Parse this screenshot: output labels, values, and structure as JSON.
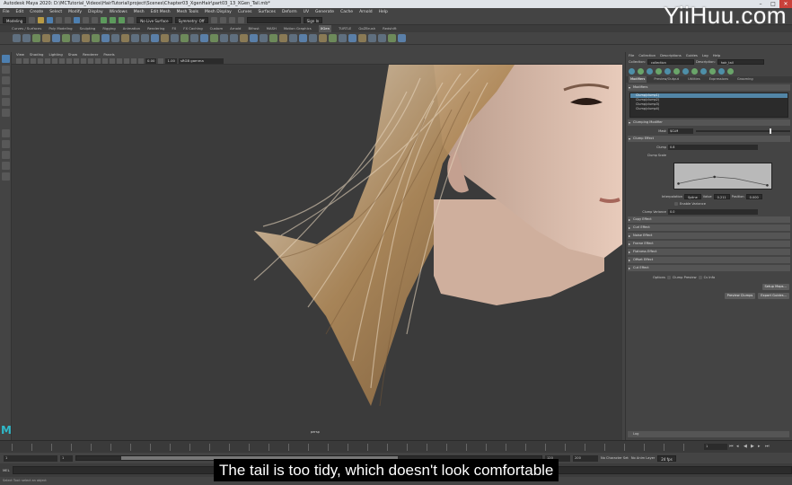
{
  "window": {
    "title": "Autodesk Maya 2020: D:\\MCTutorial_Videos\\HairTutorial\\project\\Scenes\\Chapter03_XgenHair\\part03_13_XGen_Tail.mb*",
    "controls": [
      "–",
      "□",
      "✕"
    ]
  },
  "menubar": [
    "File",
    "Edit",
    "Create",
    "Select",
    "Modify",
    "Display",
    "Windows",
    "Mesh",
    "Edit Mesh",
    "Mesh Tools",
    "Mesh Display",
    "Curves",
    "Surfaces",
    "Deform",
    "UV",
    "Generate",
    "Cache",
    "Arnold",
    "Help"
  ],
  "statusline": {
    "mode": "Modeling",
    "live_surface": "No Live Surface",
    "symmetry": "Symmetry: Off",
    "sign_in": "Sign In"
  },
  "shelf_tabs": [
    "Curves / Surfaces",
    "Poly Modeling",
    "Sculpting",
    "Rigging",
    "Animation",
    "Rendering",
    "FX",
    "FX Caching",
    "Custom",
    "Arnold",
    "Bifrost",
    "MASH",
    "Motion Graphics",
    "XGen",
    "TURTLE",
    "GoZBrush",
    "Redshift"
  ],
  "active_shelf_tab": "XGen",
  "panel_menu": [
    "View",
    "Shading",
    "Lighting",
    "Show",
    "Renderer",
    "Panels"
  ],
  "panel_tools": {
    "value_a": "0.00",
    "value_b": "1.00",
    "color_space": "sRGB gamma"
  },
  "viewport": {
    "camera_label": "persp"
  },
  "xgen": {
    "menu": [
      "File",
      "Collection",
      "Descriptions",
      "Guides",
      "Log",
      "Help"
    ],
    "collection_label": "Collection:",
    "collection_value": "collection",
    "description_label": "Description:",
    "description_value": "hair_tail",
    "tabs": [
      "Modifiers",
      "Preview/Output",
      "Utilities",
      "Expressions",
      "Grooming"
    ],
    "active_tab": "Modifiers",
    "modifiers_header": "Modifiers",
    "modifier_items": [
      "Clump(clump1)",
      "Clump(clump2)",
      "Clump(clump3)",
      "Clump(clump4)"
    ],
    "selected_modifier_index": 0,
    "clumping_header": "Clumping Modifier",
    "mask_label": "Mask",
    "mask_value": "$CLM",
    "clump_effect_header": "Clump Effect",
    "clump_label": "Clump",
    "clump_value": "0.8",
    "clump_scale_label": "Clump Scale",
    "interpolation_label": "Interpolation",
    "interpolation_value": "Spline",
    "value_label": "Value",
    "value_value": "0.211",
    "position_label": "Position",
    "position_value": "0.000",
    "enable_label": "Enable Variance",
    "clump_variance_label": "Clump Variance",
    "clump_variance_value": "0.0",
    "closed_sections": [
      "Copy Effect",
      "Curl Effect",
      "Noise Effect",
      "Frame Effect",
      "Flatness Effect",
      "Offset Effect",
      "Cut Effect"
    ],
    "options_label": "Options",
    "clump_preview_label": "Clump Preview",
    "cv_info_label": "Cv Info",
    "setup_maps_button": "Setup Maps...",
    "preview_clumps_button": "Preview Clumps",
    "export_guides_button": "Export Guides...",
    "log_label": "Log"
  },
  "timeline": {
    "current_frame": "1",
    "start_frame": "1",
    "range_start": "1",
    "range_end": "120",
    "end_a": "120",
    "end_b": "200",
    "character_set": "No Character Set",
    "anim_layer": "No Anim Layer",
    "fps": "24 fps"
  },
  "cmdline": {
    "lang": "MEL"
  },
  "helpline": "Select Tool: select an object",
  "subtitle": "The tail is too tidy, which doesn't look comfortable",
  "watermark": "YiiHuu.com",
  "colors": {
    "viewport_bg": "#3b3b3b",
    "panel_bg": "#444444",
    "accent": "#5285a6",
    "hair": "#b08a5a",
    "skin": "#d8b8a6"
  }
}
